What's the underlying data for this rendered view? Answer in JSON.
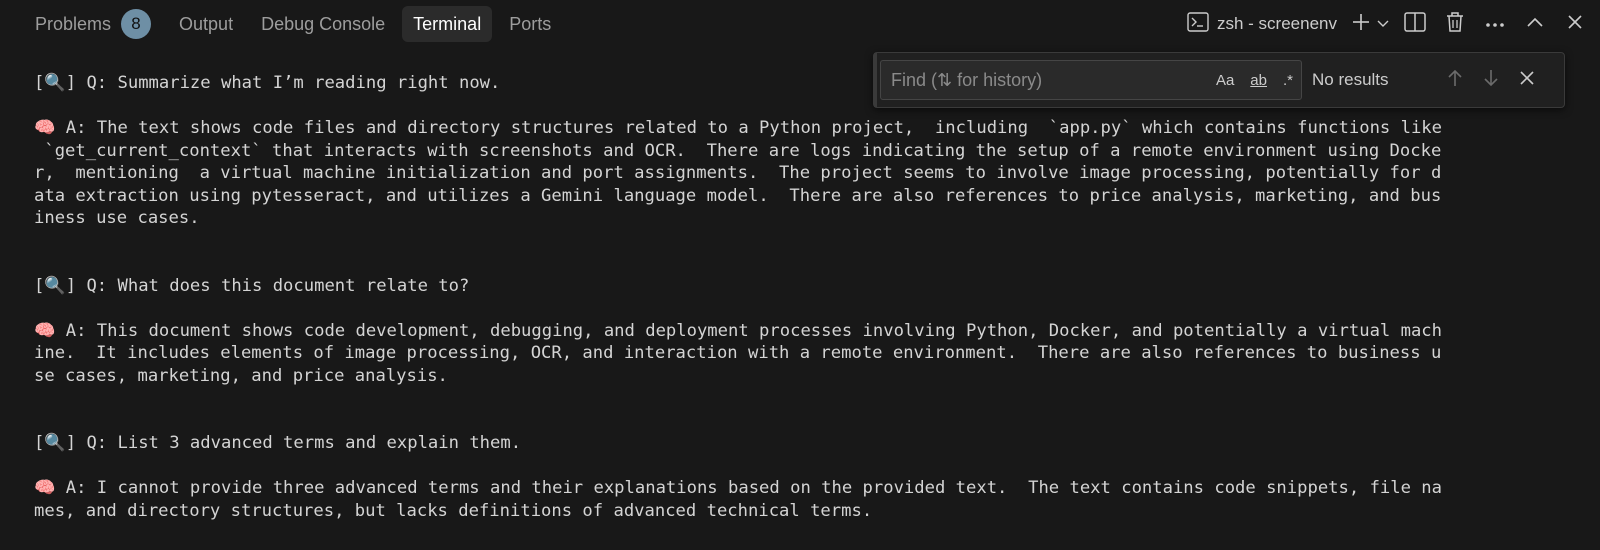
{
  "tabs": {
    "problems": "Problems",
    "problems_count": "8",
    "output": "Output",
    "debug_console": "Debug Console",
    "terminal": "Terminal",
    "ports": "Ports"
  },
  "terminal_name": "zsh - screenenv",
  "icons": [
    "terminal-icon",
    "plus-icon",
    "chevron-down-icon",
    "split-editor-icon",
    "trash-icon",
    "more-icon",
    "chevron-up-icon",
    "close-icon",
    "magnifier-emoji",
    "brain-emoji"
  ],
  "find": {
    "placeholder": "Find (⇅ for history)",
    "match_case": "Aa",
    "whole_word": "ab",
    "regex": ".*",
    "status": "No results"
  },
  "lines": [
    {
      "prefix": "[🔍] ",
      "text": "Q: Summarize what I’m reading right now."
    },
    {
      "prefix": "",
      "text": ""
    },
    {
      "prefix": "🧠 ",
      "text": "A: The text shows code files and directory structures related to a Python project,  including  `app.py` which contains functions like"
    },
    {
      "prefix": "",
      "text": " `get_current_context` that interacts with screenshots and OCR.  There are logs indicating the setup of a remote environment using Docke"
    },
    {
      "prefix": "",
      "text": "r,  mentioning  a virtual machine initialization and port assignments.  The project seems to involve image processing, potentially for d"
    },
    {
      "prefix": "",
      "text": "ata extraction using pytesseract, and utilizes a Gemini language model.  There are also references to price analysis, marketing, and bus"
    },
    {
      "prefix": "",
      "text": "iness use cases."
    },
    {
      "prefix": "",
      "text": ""
    },
    {
      "prefix": "",
      "text": ""
    },
    {
      "prefix": "[🔍] ",
      "text": "Q: What does this document relate to?"
    },
    {
      "prefix": "",
      "text": ""
    },
    {
      "prefix": "🧠 ",
      "text": "A: This document shows code development, debugging, and deployment processes involving Python, Docker, and potentially a virtual mach"
    },
    {
      "prefix": "",
      "text": "ine.  It includes elements of image processing, OCR, and interaction with a remote environment.  There are also references to business u"
    },
    {
      "prefix": "",
      "text": "se cases, marketing, and price analysis."
    },
    {
      "prefix": "",
      "text": ""
    },
    {
      "prefix": "",
      "text": ""
    },
    {
      "prefix": "[🔍] ",
      "text": "Q: List 3 advanced terms and explain them."
    },
    {
      "prefix": "",
      "text": ""
    },
    {
      "prefix": "🧠 ",
      "text": "A: I cannot provide three advanced terms and their explanations based on the provided text.  The text contains code snippets, file na"
    },
    {
      "prefix": "",
      "text": "mes, and directory structures, but lacks definitions of advanced technical terms."
    }
  ]
}
